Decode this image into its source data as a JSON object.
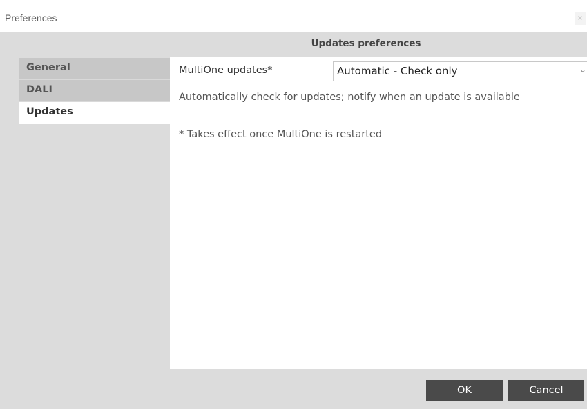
{
  "window": {
    "title": "Preferences",
    "close_label": "×"
  },
  "header": {
    "title": "Updates preferences"
  },
  "sidebar": {
    "items": [
      {
        "label": "General",
        "active": false
      },
      {
        "label": "DALI",
        "active": false
      },
      {
        "label": "Updates",
        "active": true
      }
    ]
  },
  "updates": {
    "field_label": "MultiOne updates*",
    "select_value": "Automatic - Check only",
    "description": "Automatically check for updates; notify when an update is available",
    "note": "* Takes effect once MultiOne is restarted"
  },
  "footer": {
    "ok_label": "OK",
    "cancel_label": "Cancel"
  }
}
